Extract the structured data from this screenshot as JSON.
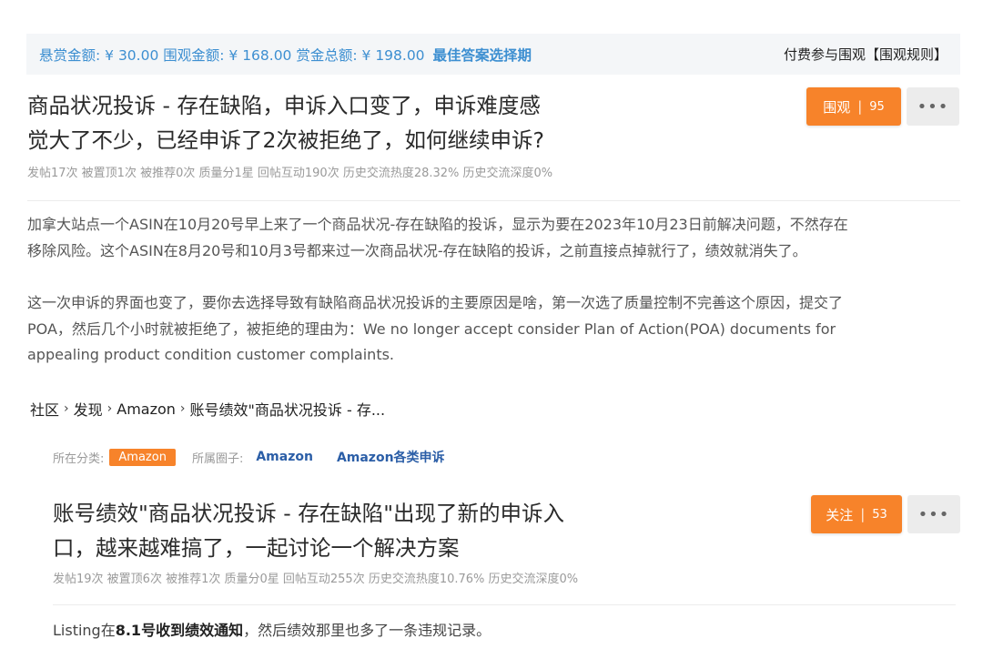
{
  "bounty": {
    "reward": "悬赏金额: ¥ 30.00",
    "watch": "围观金额: ¥ 168.00",
    "total": "赏金总额: ¥ 198.00",
    "best_answer": "最佳答案选择期",
    "paid_watch": "付费参与围观【围观规则】"
  },
  "post1": {
    "title_line1": "商品状况投诉 - 存在缺陷，申诉入口变了，申诉难度感",
    "title_line2": "觉大了不少，已经申诉了2次被拒绝了，如何继续申诉?",
    "stats": "发帖17次  被置顶1次  被推荐0次  质量分1星  回帖互动190次  历史交流热度28.32%  历史交流深度0%",
    "button_label": "围观",
    "button_count": "95",
    "more": "•••",
    "para1_line1": "加拿大站点一个ASIN在10月20号早上来了一个商品状况-存在缺陷的投诉，显示为要在2023年10月23日前解决问题，不然存在",
    "para1_line2": "移除风险。这个ASIN在8月20号和10月3号都来过一次商品状况-存在缺陷的投诉，之前直接点掉就行了，绩效就消失了。",
    "para2_line1": "这一次申诉的界面也变了，要你去选择导致有缺陷商品状况投诉的主要原因是啥，第一次选了质量控制不完善这个原因，提交了",
    "para2_line2": "POA，然后几个小时就被拒绝了，被拒绝的理由为：We no longer accept consider Plan of Action(POA) documents for",
    "para2_line3": "appealing product condition customer complaints."
  },
  "breadcrumb": {
    "items": [
      "社区",
      "发现",
      "Amazon",
      "账号绩效\"商品状况投诉 - 存..."
    ]
  },
  "category": {
    "label": "所在分类:",
    "badge": "Amazon",
    "circle_label": "所属圈子:",
    "circles": [
      "Amazon",
      "Amazon各类申诉"
    ]
  },
  "post2": {
    "title_line1": "账号绩效\"商品状况投诉 - 存在缺陷\"出现了新的申诉入",
    "title_line2": "口，越来越难搞了，一起讨论一个解决方案",
    "stats": "发帖19次  被置顶6次  被推荐1次  质量分0星  回帖互动255次  历史交流热度10.76%  历史交流深度0%",
    "button_label": "关注",
    "button_count": "53",
    "more": "•••",
    "preview_a": "Listing在",
    "preview_b": "8.1号收到绩效通知",
    "preview_c": "，然后绩效那里也多了一条违规记录。"
  },
  "colors": {
    "accent": "#f7832a",
    "link": "#3d8fd1",
    "circle": "#2b5ea7"
  }
}
